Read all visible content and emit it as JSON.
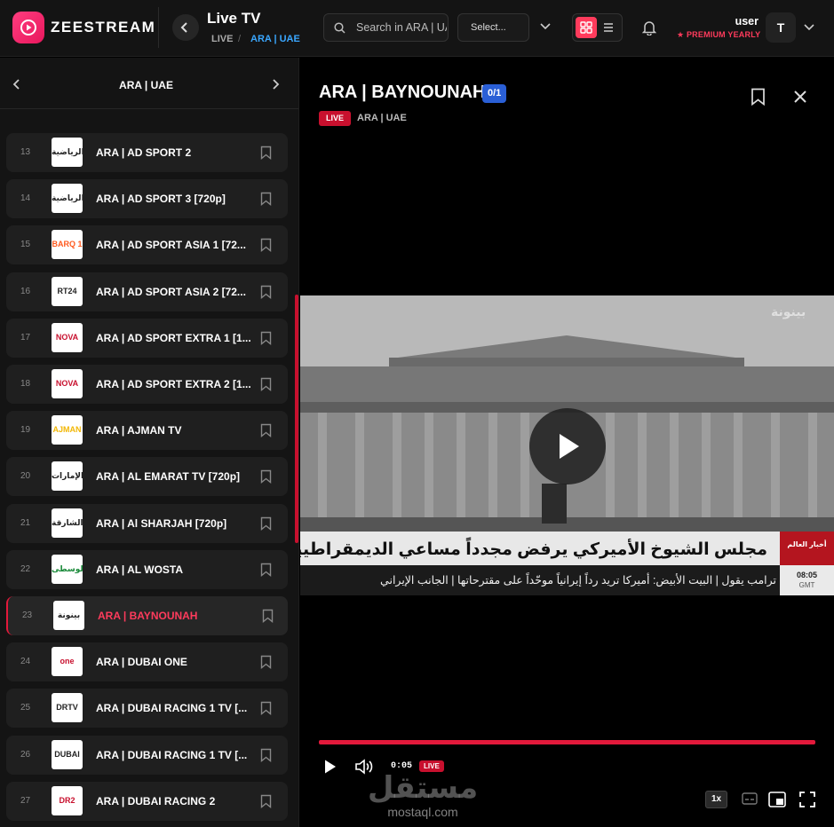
{
  "header": {
    "brand": "ZEESTREAM",
    "page_title": "Live TV",
    "breadcrumb": [
      "LIVE",
      "/",
      "ARA | UAE"
    ],
    "search_placeholder": "Search in ARA | UAE",
    "select_label": "Select...",
    "user_name": "user",
    "user_plan": "★ PREMIUM YEARLY",
    "avatar_letter": "T"
  },
  "sidebar": {
    "category": "ARA | UAE",
    "channels": [
      {
        "num": "13",
        "name": "ARA | AD SPORT 2",
        "logo": "الرياضية",
        "logo_color": "#222",
        "active": false
      },
      {
        "num": "14",
        "name": "ARA | AD SPORT 3 [720p]",
        "logo": "الرياضية",
        "logo_color": "#222",
        "active": false
      },
      {
        "num": "15",
        "name": "ARA | AD SPORT ASIA 1 [72...",
        "logo": "BARQ 1",
        "logo_color": "#ff5a1f",
        "active": false
      },
      {
        "num": "16",
        "name": "ARA | AD SPORT ASIA 2 [72...",
        "logo": "RT24",
        "logo_color": "#222",
        "active": false
      },
      {
        "num": "17",
        "name": "ARA | AD SPORT EXTRA 1 [1...",
        "logo": "NOVA",
        "logo_color": "#c8102e",
        "active": false
      },
      {
        "num": "18",
        "name": "ARA | AD SPORT EXTRA 2 [1...",
        "logo": "NOVA",
        "logo_color": "#c8102e",
        "active": false
      },
      {
        "num": "19",
        "name": "ARA | AJMAN TV",
        "logo": "AJMAN",
        "logo_color": "#f2b705",
        "active": false
      },
      {
        "num": "20",
        "name": "ARA | AL EMARAT TV [720p]",
        "logo": "الإمارات",
        "logo_color": "#222",
        "active": false
      },
      {
        "num": "21",
        "name": "ARA | Al SHARJAH [720p]",
        "logo": "الشارقة",
        "logo_color": "#222",
        "active": false
      },
      {
        "num": "22",
        "name": "ARA | AL WOSTA",
        "logo": "الوسطى",
        "logo_color": "#1a8a3a",
        "active": false
      },
      {
        "num": "23",
        "name": "ARA | BAYNOUNAH",
        "logo": "بينونة",
        "logo_color": "#222",
        "active": true
      },
      {
        "num": "24",
        "name": "ARA | DUBAI ONE",
        "logo": "one",
        "logo_color": "#c8102e",
        "active": false
      },
      {
        "num": "25",
        "name": "ARA | DUBAI RACING 1 TV [...",
        "logo": "DRTV",
        "logo_color": "#222",
        "active": false
      },
      {
        "num": "26",
        "name": "ARA | DUBAI RACING 1 TV [...",
        "logo": "DUBAI",
        "logo_color": "#222",
        "active": false
      },
      {
        "num": "27",
        "name": "ARA | DUBAI RACING 2",
        "logo": "DR2",
        "logo_color": "#c8102e",
        "active": false
      }
    ]
  },
  "player": {
    "title": "ARA | BAYNOUNAH",
    "count": "0/1",
    "live_label": "LIVE",
    "subtitle": "ARA | UAE",
    "headline": "مجلس الشيوخ الأميركي يرفض مجدداً مساعي الديمقراطيين لوقف حرب إيران",
    "news_channel": "أخبار العالم",
    "ticker": "ترامب يقول   |   البيت الأبيض: أميركا تريد رداً إيرانياً موحّداً على مقترحاتها   |   الجانب الإيراني",
    "clock_time": "08:05",
    "clock_zone": "GMT",
    "channel_watermark": "بينونة",
    "elapsed": "0:05",
    "speed": "1x",
    "site_watermark_ar": "مستقل",
    "site_watermark_en": "mostaql.com"
  },
  "colors": {
    "accent": "#e3193b",
    "link": "#3aa7ff",
    "badge_blue": "#2a5fd6"
  }
}
